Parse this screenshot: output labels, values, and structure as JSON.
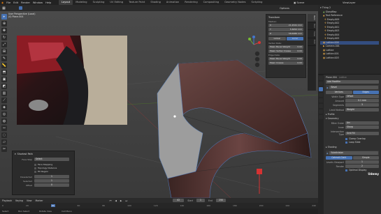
{
  "menu": [
    "File",
    "Edit",
    "Render",
    "Window",
    "Help"
  ],
  "workspaces": [
    "Layout",
    "Modeling",
    "Sculpting",
    "UV Editing",
    "Texture Paint",
    "Shading",
    "Animation",
    "Rendering",
    "Compositing",
    "Geometry Nodes",
    "Scripting"
  ],
  "active_workspace": "Layout",
  "scene": "Scene",
  "view_layer": "ViewLayer",
  "viewport": {
    "header_overlay_line1": "User Perspective (Local)",
    "header_overlay_line2": "(0) Plane.004",
    "options_label": "Options"
  },
  "npanel": {
    "section1": "Transform",
    "median": "Median:",
    "x": "X",
    "x_val": "21.4541 mm",
    "y": "Y",
    "y_val": "5.6052 mm",
    "z": "Z",
    "z_val": "58.6686 mm",
    "global": "Global",
    "local": "Local",
    "vertex_data": "Vertex Data:",
    "bevel_weight": "Mean Bevel Weight",
    "bevel_weight_val": "0.00",
    "vertex_crease": "Mean Vertex Crease",
    "vertex_crease_val": "0.00",
    "edge_data": "Edge Data:",
    "edge_bevel": "Mean Bevel Weight",
    "edge_bevel_val": "0.00",
    "mean_crease": "Mean Crease",
    "mean_crease_val": "0.00",
    "tabs": [
      "Item",
      "Tool",
      "View",
      "Edit"
    ]
  },
  "redo_panel": {
    "title": "Shortest Path",
    "face_step_label": "Face Step",
    "face_step_value": "Select",
    "options": [
      "Face Stepping",
      "Topology Distance",
      "Fill Region"
    ],
    "deselected_label": "Deselected",
    "deselected_value": "1",
    "selected_label": "Selected",
    "selected_value": "1",
    "offset_label": "Offset",
    "offset_value": "0"
  },
  "outliner": {
    "items": [
      "Thing 2",
      "GlassMap",
      "Text Reference",
      "Empty.009",
      "Empty.002",
      "Empty.001",
      "Empty.003",
      "Empty.004",
      "Empty.005",
      "Lattice.000",
      "Camera.001",
      "Lattice",
      "Lattice.001",
      "Lattice.003"
    ],
    "selected_index": 9
  },
  "properties": {
    "object": "Plane.004",
    "modifier_label": "Lattice",
    "add_modifier": "Add Modifier",
    "bevel_name": "Bevel",
    "vertices": "Vertices",
    "edges": "Edges",
    "width_type_label": "Width Type",
    "width_type": "Offset",
    "amount_label": "Amount",
    "amount": "0.1 mm",
    "segments_label": "Segments",
    "segments": "3",
    "limit_method_label": "Limit Method",
    "limit_method": "Weight",
    "profile": "Profile",
    "geometry": "Geometry",
    "miter_outer_label": "Miter Outer",
    "miter_outer": "Arc",
    "inner_label": "Inner",
    "inner": "Sharp",
    "intersection_label": "Intersection Type",
    "intersection": "Grid Fill",
    "clamp_overlap": "Clamp Overlap",
    "loop_slide": "Loop Slide",
    "shading": "Shading",
    "subdiv_name": "Subdivision",
    "catmull": "Catmull-Clark",
    "simple": "Simple",
    "levels_viewport_label": "Levels Viewport",
    "levels_viewport": "1",
    "render_label": "Render",
    "render": "2",
    "optimal_display": "Optimal Display",
    "udemy": "Udemy"
  },
  "timeline": {
    "playback": "Playback",
    "keying": "Keying",
    "view": "View",
    "marker": "Marker",
    "frame": "42",
    "start_label": "Start",
    "start": "1",
    "end_label": "End",
    "end": "250",
    "ticks": [
      "0",
      "20",
      "40",
      "60",
      "80",
      "100",
      "120",
      "140",
      "160",
      "180",
      "200",
      "220",
      "240"
    ],
    "status_select": "Select",
    "status_box": "Box Select",
    "status_rotate": "Rotate View",
    "status_menu": "Call Menu"
  }
}
